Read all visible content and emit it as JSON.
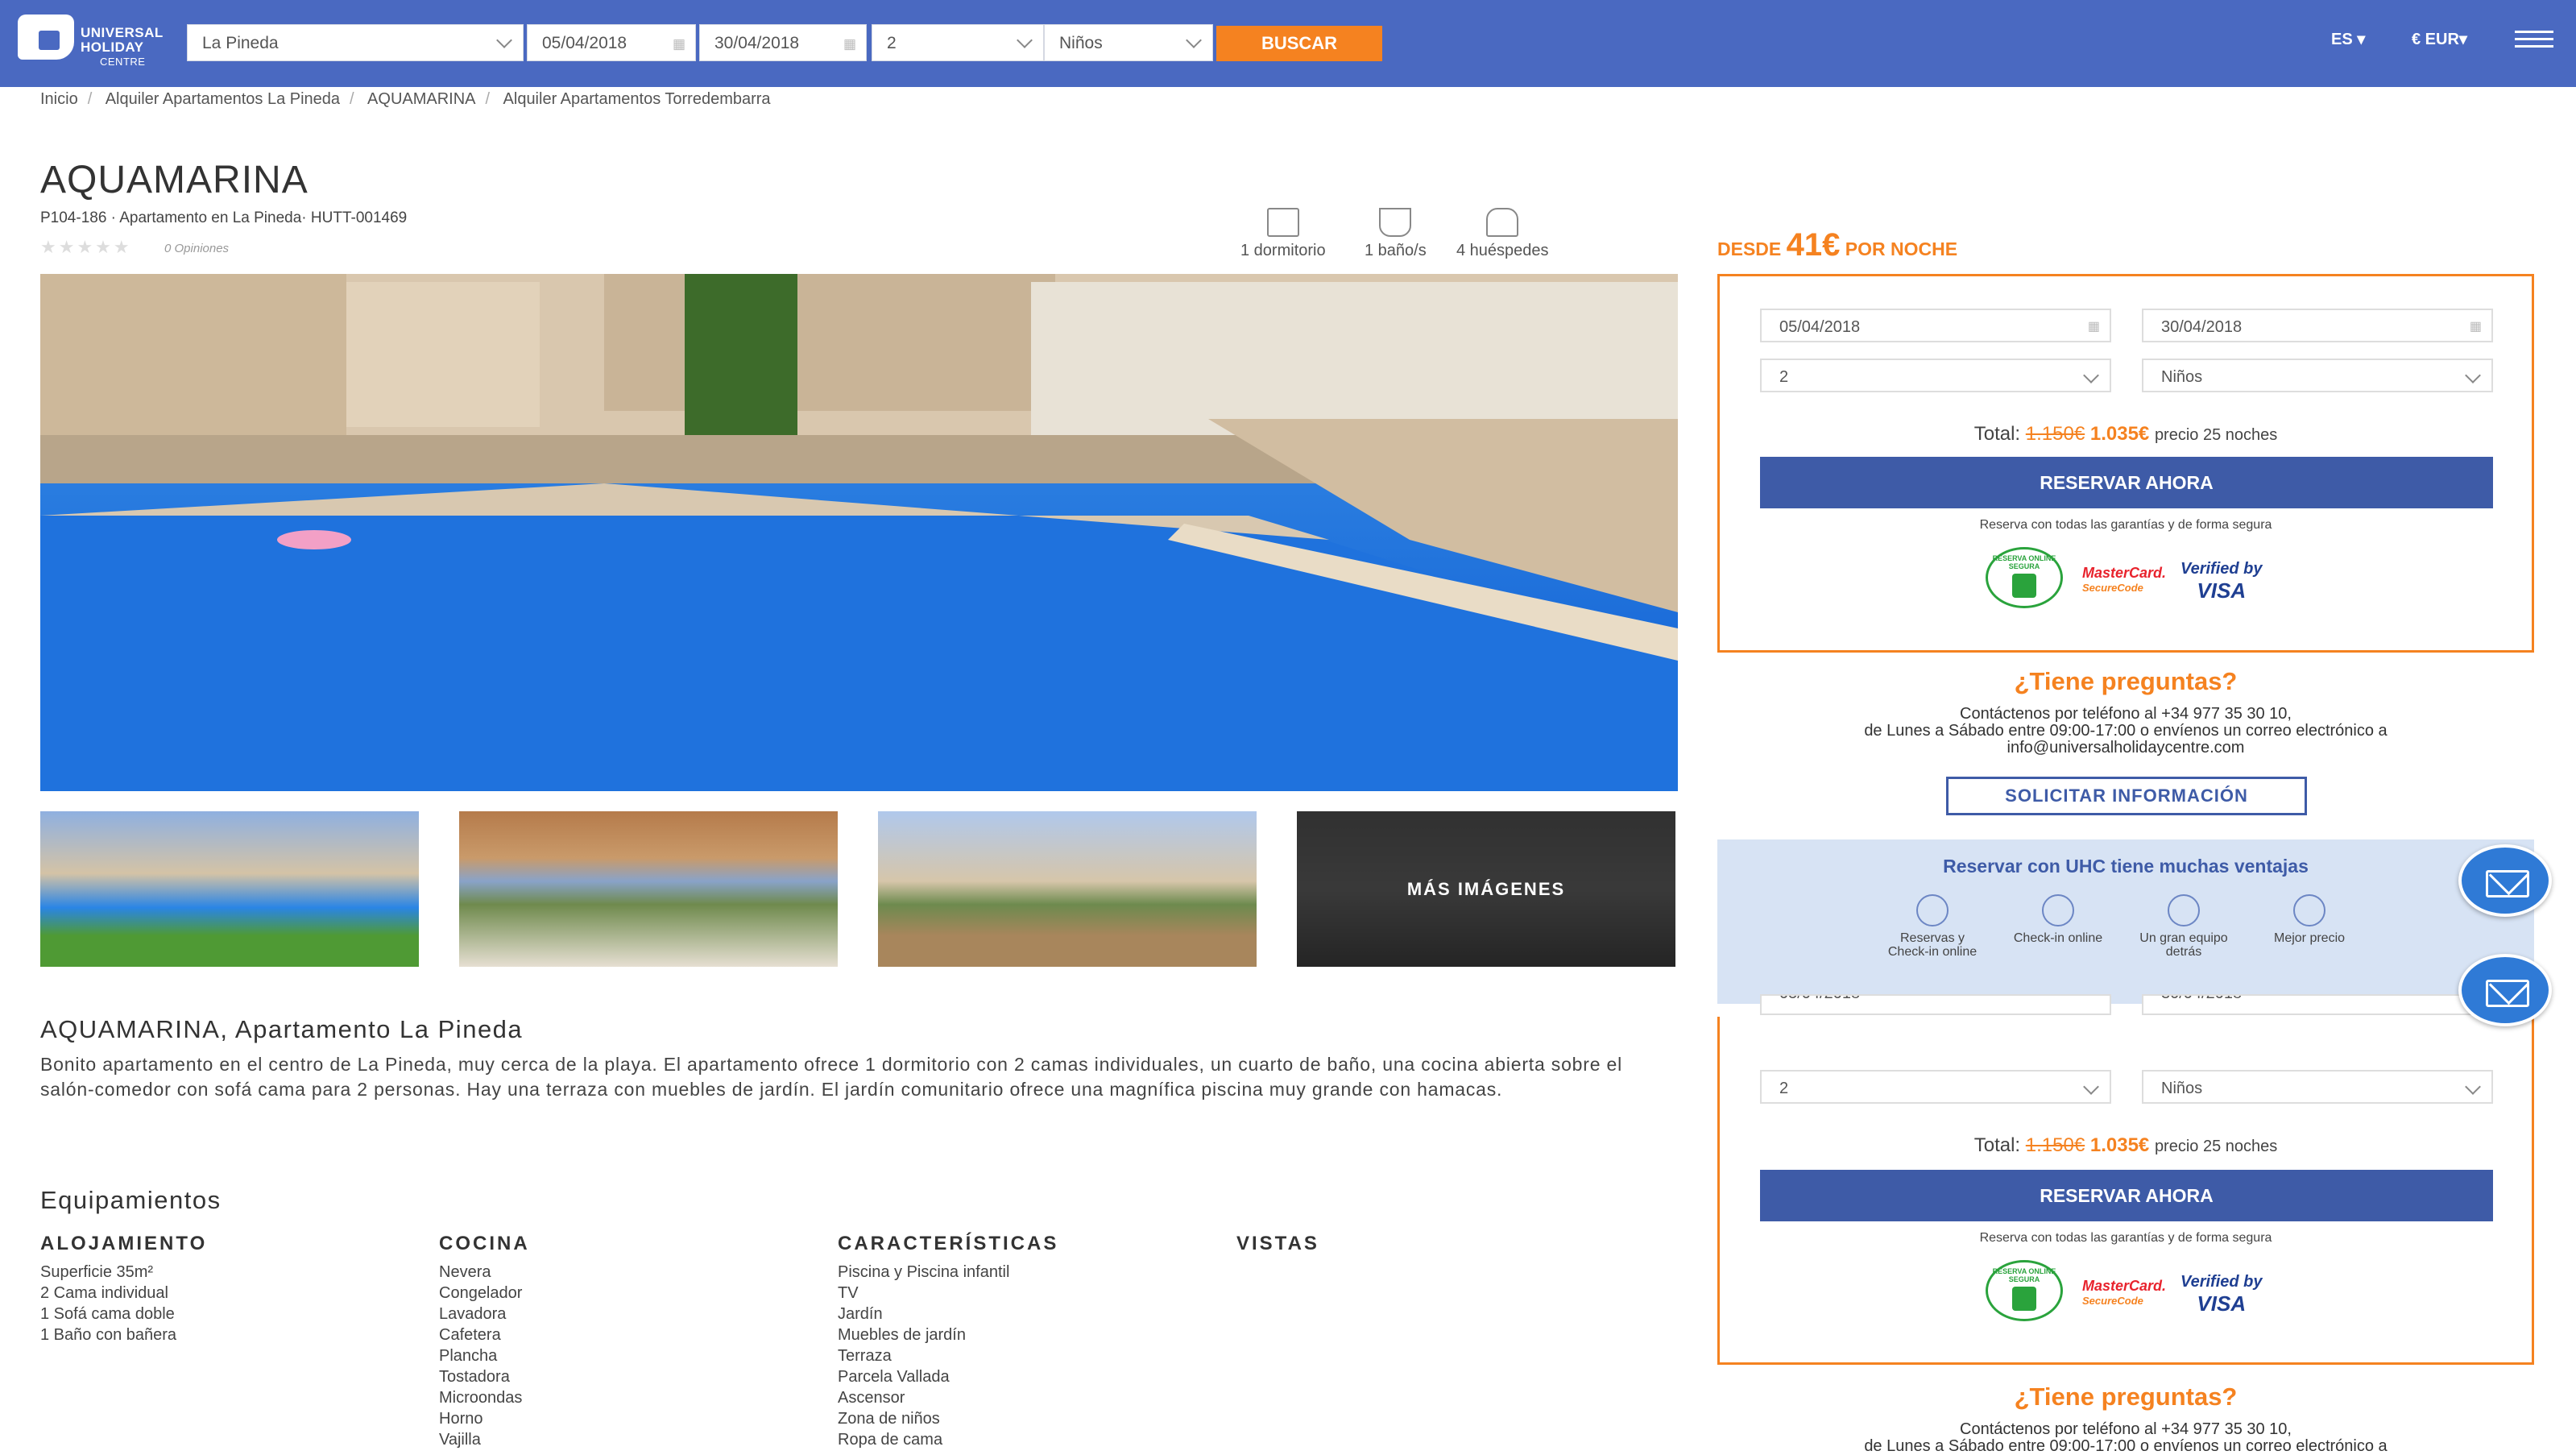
{
  "header": {
    "logo_line1": "UNIVERSAL",
    "logo_line2": "HOLIDAY",
    "logo_line3": "CENTRE",
    "destination": "La Pineda",
    "checkin": "05/04/2018",
    "checkout": "30/04/2018",
    "adults": "2",
    "children": "Niños",
    "search_label": "BUSCAR",
    "language": "ES",
    "currency": "€ EUR"
  },
  "breadcrumb": [
    "Inicio",
    "Alquiler Apartamentos La Pineda",
    "AQUAMARINA",
    "Alquiler Apartamentos Torredembarra"
  ],
  "property": {
    "title": "AQUAMARINA",
    "subtitle": "P104-186 · Apartamento en La Pineda· HUTT-001469",
    "stars": "★★★★★",
    "reviews": "0 Opiniones",
    "features": [
      "1 dormitorio",
      "1 baño/s",
      "4 huéspedes"
    ],
    "more_images": "MÁS IMÁGENES",
    "heading": "AQUAMARINA, Apartamento La Pineda",
    "description": "Bonito apartamento en el centro de La Pineda, muy cerca de la playa. El apartamento ofrece 1 dormitorio con 2 camas individuales, un cuarto de baño, una cocina abierta sobre el salón-comedor con sofá cama para 2 personas. Hay una terraza con muebles de jardín. El jardín comunitario ofrece una magnífica piscina muy grande con hamacas."
  },
  "amenities": {
    "title": "Equipamientos",
    "columns": [
      {
        "heading": "ALOJAMIENTO",
        "items": [
          "Superficie 35m²",
          "2 Cama individual",
          "1 Sofá cama doble",
          "1 Baño con bañera"
        ]
      },
      {
        "heading": "COCINA",
        "items": [
          "Nevera",
          "Congelador",
          "Lavadora",
          "Cafetera",
          "Plancha",
          "Tostadora",
          "Microondas",
          "Horno",
          "Vajilla"
        ]
      },
      {
        "heading": "CARACTERÍSTICAS",
        "items": [
          "Piscina y Piscina infantil",
          "TV",
          "Jardín",
          "Muebles de jardín",
          "Terraza",
          "Parcela Vallada",
          "Ascensor",
          "Zona de niños",
          "Ropa de cama"
        ]
      },
      {
        "heading": "VISTAS",
        "items": []
      }
    ]
  },
  "booking": {
    "price_prefix": "DESDE",
    "price_value": "41€",
    "price_suffix": "POR NOCHE",
    "checkin": "05/04/2018",
    "checkout": "30/04/2018",
    "adults": "2",
    "children": "Niños",
    "total_label": "Total:",
    "total_old": "1.150€",
    "total_new": "1.035€",
    "total_nights": "precio 25 noches",
    "reserve_label": "RESERVAR AHORA",
    "secure_text": "Reserva con todas las garantías y de forma segura",
    "badge_secure": "RESERVA ONLINE SEGURA",
    "badge_mc_1": "MasterCard.",
    "badge_mc_2": "SecureCode",
    "badge_visa_1": "Verified by",
    "badge_visa_2": "VISA"
  },
  "contact": {
    "title": "¿Tiene preguntas?",
    "line1": "Contáctenos por teléfono al +34 977 35 30 10,",
    "line2": "de Lunes a Sábado entre 09:00-17:00 o envíenos un correo electrónico a",
    "line3": "info@universalholidaycentre.com",
    "button": "SOLICITAR INFORMACIÓN"
  },
  "advantages": {
    "title": "Reservar con UHC tiene muchas ventajas",
    "items": [
      "Reservas y Check-in online",
      "Check-in online",
      "Un gran equipo detrás",
      "Mejor precio"
    ]
  }
}
